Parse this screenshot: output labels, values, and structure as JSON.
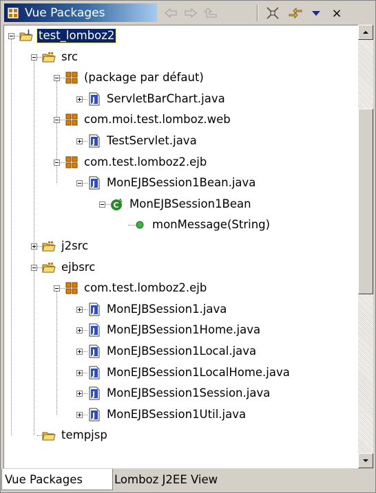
{
  "view_title": "Vue Packages",
  "toolbar": {
    "back_icon": "back-arrow-icon",
    "forward_icon": "forward-arrow-icon",
    "up_icon": "up-arrow-icon",
    "collapse_icon": "collapse-all-icon",
    "link_icon": "link-with-editor-icon",
    "menu_icon": "view-menu-icon",
    "close_label": "×"
  },
  "tree": [
    {
      "label": "test_lomboz2",
      "type": "project",
      "depth": 0,
      "expander": "minus",
      "selected": true
    },
    {
      "label": "src",
      "type": "source-folder",
      "depth": 1,
      "expander": "minus"
    },
    {
      "label": "(package par défaut)",
      "type": "package",
      "depth": 2,
      "expander": "minus"
    },
    {
      "label": "ServletBarChart.java",
      "type": "java-file",
      "depth": 3,
      "expander": "plus"
    },
    {
      "label": "com.moi.test.lomboz.web",
      "type": "package",
      "depth": 2,
      "expander": "minus"
    },
    {
      "label": "TestServlet.java",
      "type": "java-file",
      "depth": 3,
      "expander": "plus"
    },
    {
      "label": "com.test.lomboz2.ejb",
      "type": "package",
      "depth": 2,
      "expander": "minus"
    },
    {
      "label": "MonEJBSession1Bean.java",
      "type": "java-file",
      "depth": 3,
      "expander": "minus"
    },
    {
      "label": "MonEJBSession1Bean",
      "type": "class",
      "depth": 4,
      "expander": "minus"
    },
    {
      "label": "monMessage(String)",
      "type": "method",
      "depth": 5,
      "expander": "none"
    },
    {
      "label": "j2src",
      "type": "source-folder",
      "depth": 1,
      "expander": "plus"
    },
    {
      "label": "ejbsrc",
      "type": "source-folder",
      "depth": 1,
      "expander": "minus"
    },
    {
      "label": "com.test.lomboz2.ejb",
      "type": "package",
      "depth": 2,
      "expander": "minus"
    },
    {
      "label": "MonEJBSession1.java",
      "type": "java-file",
      "depth": 3,
      "expander": "plus"
    },
    {
      "label": "MonEJBSession1Home.java",
      "type": "java-file",
      "depth": 3,
      "expander": "plus"
    },
    {
      "label": "MonEJBSession1Local.java",
      "type": "java-file",
      "depth": 3,
      "expander": "plus"
    },
    {
      "label": "MonEJBSession1LocalHome.java",
      "type": "java-file",
      "depth": 3,
      "expander": "plus"
    },
    {
      "label": "MonEJBSession1Session.java",
      "type": "java-file",
      "depth": 3,
      "expander": "plus"
    },
    {
      "label": "MonEJBSession1Util.java",
      "type": "java-file",
      "depth": 3,
      "expander": "plus"
    },
    {
      "label": "tempjsp",
      "type": "folder",
      "depth": 1,
      "expander": "none"
    }
  ],
  "tabs": [
    {
      "label": "Vue Packages",
      "active": true
    },
    {
      "label": "Lomboz J2EE View",
      "active": false
    }
  ],
  "colors": {
    "title_gradient_start": "#0a246a",
    "title_gradient_end": "#a6caf0",
    "selection": "#0a246a",
    "package_icon": "#c87800",
    "folder_icon": "#f0c040",
    "java_icon": "#1c3c9c",
    "class_icon": "#2a8a2a",
    "method_icon": "#2ca02c"
  }
}
